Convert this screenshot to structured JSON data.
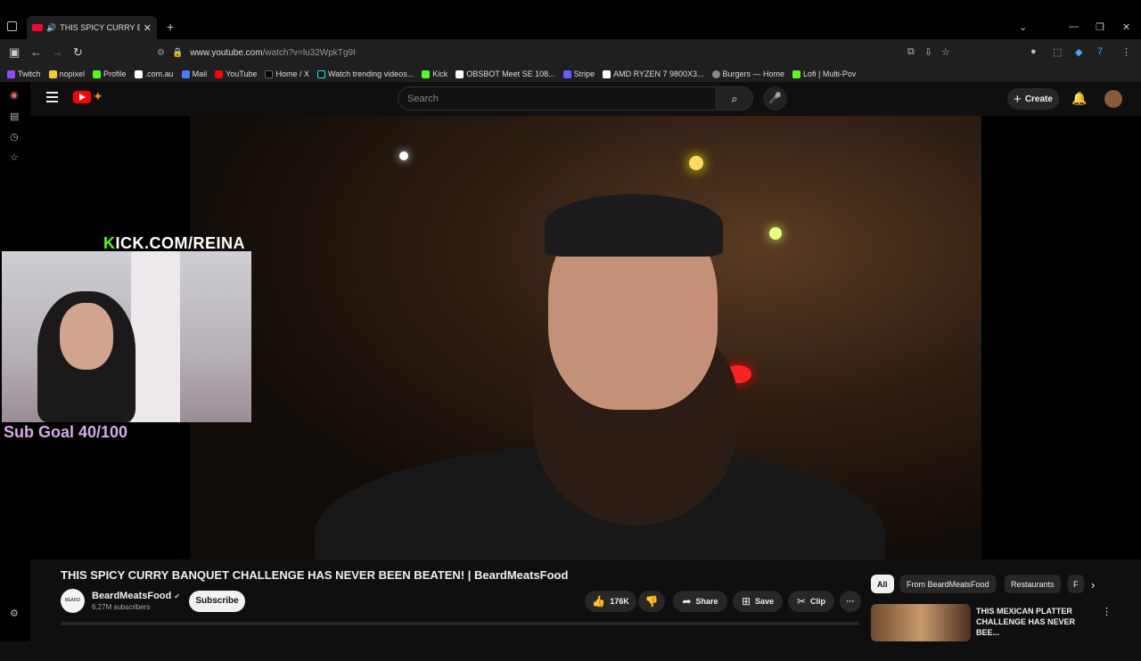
{
  "browser": {
    "tab_title": "THIS SPICY CURRY BANQUET",
    "tab_close": "✕",
    "new_tab": "+",
    "url_host": "www.youtube.com",
    "url_path": "/watch?v=lu32WpkTg9I",
    "window_controls": [
      "⌄",
      "—",
      "❐",
      "✕"
    ]
  },
  "bookmarks": [
    {
      "label": "Twitch",
      "color": "#9146ff"
    },
    {
      "label": "nopixel",
      "color": "#f5d020"
    },
    {
      "label": "Profile",
      "color": "#53fc18"
    },
    {
      "label": ".com.au",
      "color": "#ffffff"
    },
    {
      "label": "Mail",
      "color": "#4a7cff"
    },
    {
      "label": "YouTube",
      "color": "#ff0000"
    },
    {
      "label": "Home / X",
      "color": "#000000"
    },
    {
      "label": "Watch trending videos...",
      "color": "#ffffff"
    },
    {
      "label": "Kick",
      "color": "#53fc18"
    },
    {
      "label": "OBSBOT Meet SE 108...",
      "color": "#ffffff"
    },
    {
      "label": "Stripe",
      "color": "#635bff"
    },
    {
      "label": "AMD RYZEN 7 9800X3...",
      "color": "#ffffff"
    },
    {
      "label": "Burgers — Home",
      "color": "#888888"
    },
    {
      "label": "Lofi | Multi-Pov",
      "color": "#53fc18"
    }
  ],
  "youtube": {
    "search_placeholder": "Search",
    "create_label": "Create"
  },
  "overlay": {
    "kick_k": "K",
    "kick_rest": "ICK.COM/REINA",
    "sub_goal": "Sub Goal 40/100"
  },
  "video": {
    "title": "THIS SPICY CURRY BANQUET CHALLENGE HAS NEVER BEEN BEATEN! | BeardMeatsFood",
    "channel_name": "BeardMeatsFood",
    "channel_avatar_text": "BEARD MEATS FOOD",
    "verified": "✔",
    "subscribers": "6.27M subscribers",
    "subscribe_label": "Subscribe",
    "likes": "176K",
    "share_label": "Share",
    "save_label": "Save",
    "clip_label": "Clip",
    "more": "···"
  },
  "chips": [
    "All",
    "From BeardMeatsFood",
    "Restaurants",
    "F"
  ],
  "recommended": {
    "title": "THIS MEXICAN PLATTER CHALLENGE HAS NEVER BEE...",
    "more": "⋮"
  },
  "colors": {
    "youtube_red": "#ff0000",
    "kick_green": "#53fc18",
    "sub_goal": "#d8a9ea"
  }
}
